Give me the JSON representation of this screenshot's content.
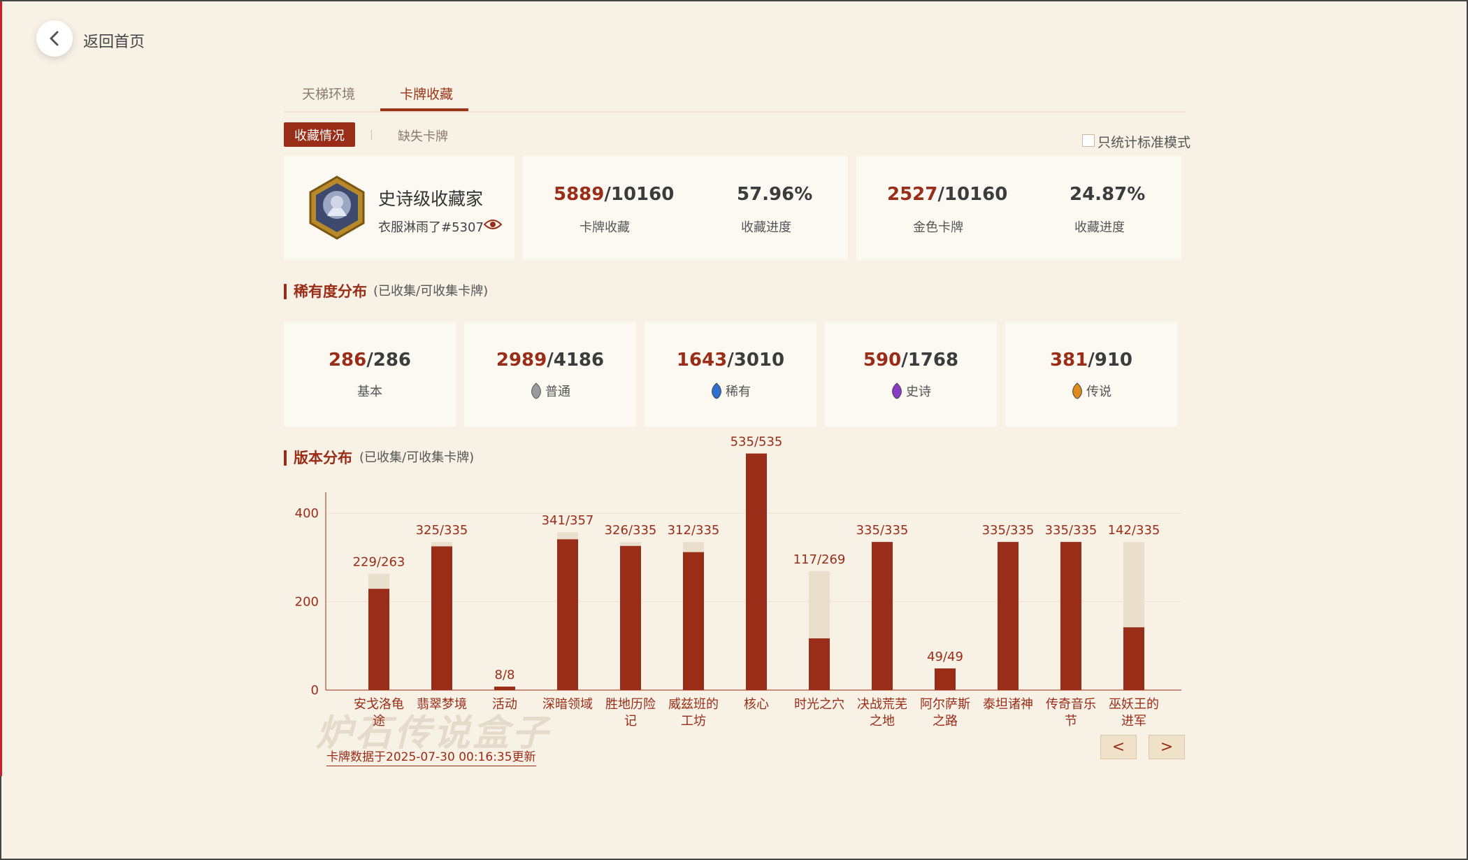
{
  "nav": {
    "back_label": "返回首页"
  },
  "tabs": [
    {
      "label": "天梯环境",
      "active": false
    },
    {
      "label": "卡牌收藏",
      "active": true
    }
  ],
  "subtabs": {
    "active": "收藏情况",
    "inactive": "缺失卡牌"
  },
  "standard_only": {
    "label": "只统计标准模式",
    "checked": false
  },
  "profile": {
    "title": "史诗级收藏家",
    "username": "衣服淋雨了#5307"
  },
  "card_stats": {
    "owned": "5889",
    "total": "/10160",
    "label": "卡牌收藏",
    "progress": "57.96%",
    "progress_label": "收藏进度"
  },
  "gold_stats": {
    "owned": "2527",
    "total": "/10160",
    "label": "金色卡牌",
    "progress": "24.87%",
    "progress_label": "收藏进度"
  },
  "rarity_section": {
    "title": "稀有度分布",
    "subtitle": "(已收集/可收集卡牌)"
  },
  "rarity": [
    {
      "owned": "286",
      "total": "/286",
      "label": "基本",
      "gem": "none",
      "color": ""
    },
    {
      "owned": "2989",
      "total": "/4186",
      "label": "普通",
      "gem": "common-gem-icon",
      "color": "#9a9a9a"
    },
    {
      "owned": "1643",
      "total": "/3010",
      "label": "稀有",
      "gem": "rare-gem-icon",
      "color": "#2f6fd0"
    },
    {
      "owned": "590",
      "total": "/1768",
      "label": "史诗",
      "gem": "epic-gem-icon",
      "color": "#8a3cc9"
    },
    {
      "owned": "381",
      "total": "/910",
      "label": "传说",
      "gem": "legendary-gem-icon",
      "color": "#e08a1e"
    }
  ],
  "set_section": {
    "title": "版本分布",
    "subtitle": "(已收集/可收集卡牌)"
  },
  "chart_data": {
    "type": "bar",
    "categories": [
      "安戈洛龟途",
      "翡翠梦境",
      "活动",
      "深暗领域",
      "胜地历险记",
      "威兹班的工坊",
      "核心",
      "时光之穴",
      "决战荒芜之地",
      "阿尔萨斯之路",
      "泰坦诸神",
      "传奇音乐节",
      "巫妖王的进军"
    ],
    "category_lines": [
      [
        "安戈洛龟",
        "途"
      ],
      [
        "翡翠梦境"
      ],
      [
        "活动"
      ],
      [
        "深暗领域"
      ],
      [
        "胜地历险",
        "记"
      ],
      [
        "威兹班的",
        "工坊"
      ],
      [
        "核心"
      ],
      [
        "时光之穴"
      ],
      [
        "决战荒芜",
        "之地"
      ],
      [
        "阿尔萨斯",
        "之路"
      ],
      [
        "泰坦诸神"
      ],
      [
        "传奇音乐",
        "节"
      ],
      [
        "巫妖王的",
        "进军"
      ]
    ],
    "series": [
      {
        "name": "已收集",
        "values": [
          229,
          325,
          8,
          341,
          326,
          312,
          535,
          117,
          335,
          49,
          335,
          335,
          142
        ]
      },
      {
        "name": "可收集",
        "values": [
          263,
          335,
          8,
          357,
          335,
          335,
          535,
          269,
          335,
          49,
          335,
          335,
          335
        ]
      }
    ],
    "data_labels": [
      "229/263",
      "325/335",
      "8/8",
      "341/357",
      "326/335",
      "312/335",
      "535/535",
      "117/269",
      "335/335",
      "49/49",
      "335/335",
      "335/335",
      "142/335"
    ],
    "ylim": [
      0,
      400
    ],
    "yticks": [
      "0",
      "200",
      "400"
    ],
    "grid": true,
    "colors": {
      "owned": "#9a2d17",
      "collectable": "#eadfcc"
    }
  },
  "pager": {
    "prev": "<",
    "next": ">"
  },
  "update_note": "卡牌数据于2025-07-30 00:16:35更新",
  "watermark": "炉石传说盒子"
}
